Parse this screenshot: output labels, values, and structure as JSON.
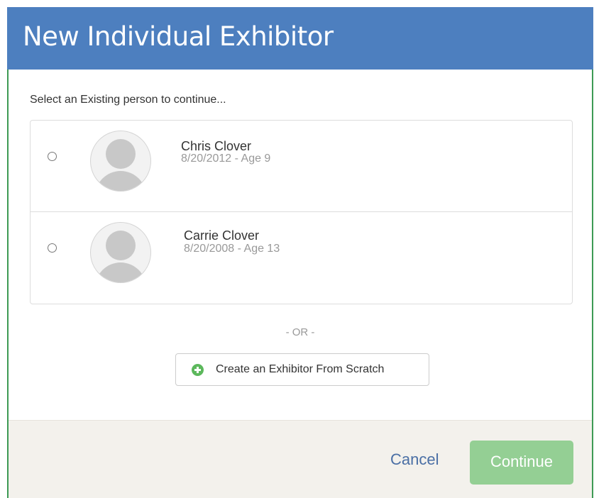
{
  "dialog": {
    "title": "New Individual Exhibitor",
    "prompt": "Select an Existing person to continue...",
    "people": [
      {
        "name": "Chris Clover",
        "dob": "8/20/2012 - Age 9"
      },
      {
        "name": "Carrie Clover",
        "dob": "8/20/2008 - Age 13"
      }
    ],
    "or_text": "- OR -",
    "create_label": "Create an Exhibitor From Scratch",
    "cancel_label": "Cancel",
    "continue_label": "Continue"
  },
  "colors": {
    "header": "#4d7fbf",
    "create_icon": "#5cb85c",
    "continue_disabled": "#94cf94",
    "cancel_link": "#4a6fa5",
    "footer": "#f3f1ec"
  },
  "icons": {
    "avatar": "default-avatar-icon",
    "create": "plus-circle-icon"
  }
}
